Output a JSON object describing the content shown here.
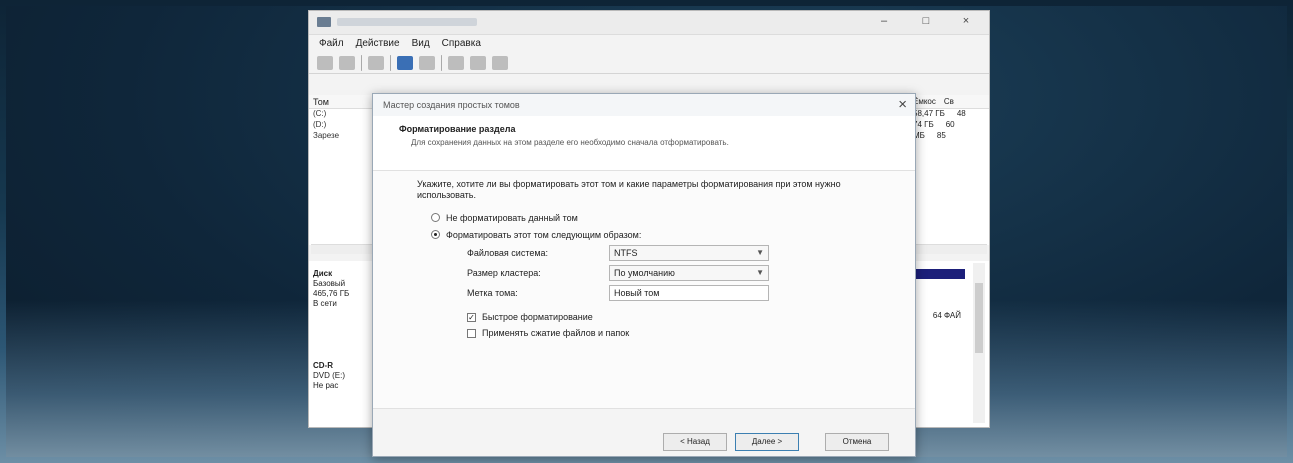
{
  "window": {
    "controls": {
      "minimize": "–",
      "maximize": "□",
      "close": "×"
    },
    "menu": [
      "Файл",
      "Действие",
      "Вид",
      "Справка"
    ],
    "volume_table": {
      "header": "Том",
      "rows": [
        "(С:)",
        "(D:)",
        "Зарезе"
      ],
      "size_header": "Ёмкос",
      "free_header": "Св",
      "sizes": [
        "58,47 ГБ",
        "74 ГБ",
        "МБ"
      ],
      "free": [
        "48",
        "60",
        "85"
      ]
    },
    "disk0": {
      "label": "Диск",
      "type": "Базовый",
      "size": "465,76 ГБ",
      "status": "В сети",
      "partition_text": "64 ФАЙ"
    },
    "cdrom": {
      "label": "CD-R",
      "type": "DVD (E:)",
      "status": "Не рас"
    }
  },
  "dialog": {
    "title": "Мастер создания простых томов",
    "close": "×",
    "header_title": "Форматирование раздела",
    "header_desc": "Для сохранения данных на этом разделе его необходимо сначала отформатировать.",
    "prompt": "Укажите, хотите ли вы форматировать этот том и какие параметры форматирования при этом нужно использовать.",
    "option_no_format": "Не форматировать данный том",
    "option_format": "Форматировать этот том следующим образом:",
    "fs_label": "Файловая система:",
    "fs_value": "NTFS",
    "cluster_label": "Размер кластера:",
    "cluster_value": "По умолчанию",
    "volume_label_label": "Метка тома:",
    "volume_label_value": "Новый том",
    "quick_format": "Быстрое форматирование",
    "compress": "Применять сжатие файлов и папок",
    "btn_back": "< Назад",
    "btn_next": "Далее >",
    "btn_cancel": "Отмена"
  },
  "colors": {
    "accent": "#3c7fb1",
    "partition_bar": "#1c1f7a"
  }
}
